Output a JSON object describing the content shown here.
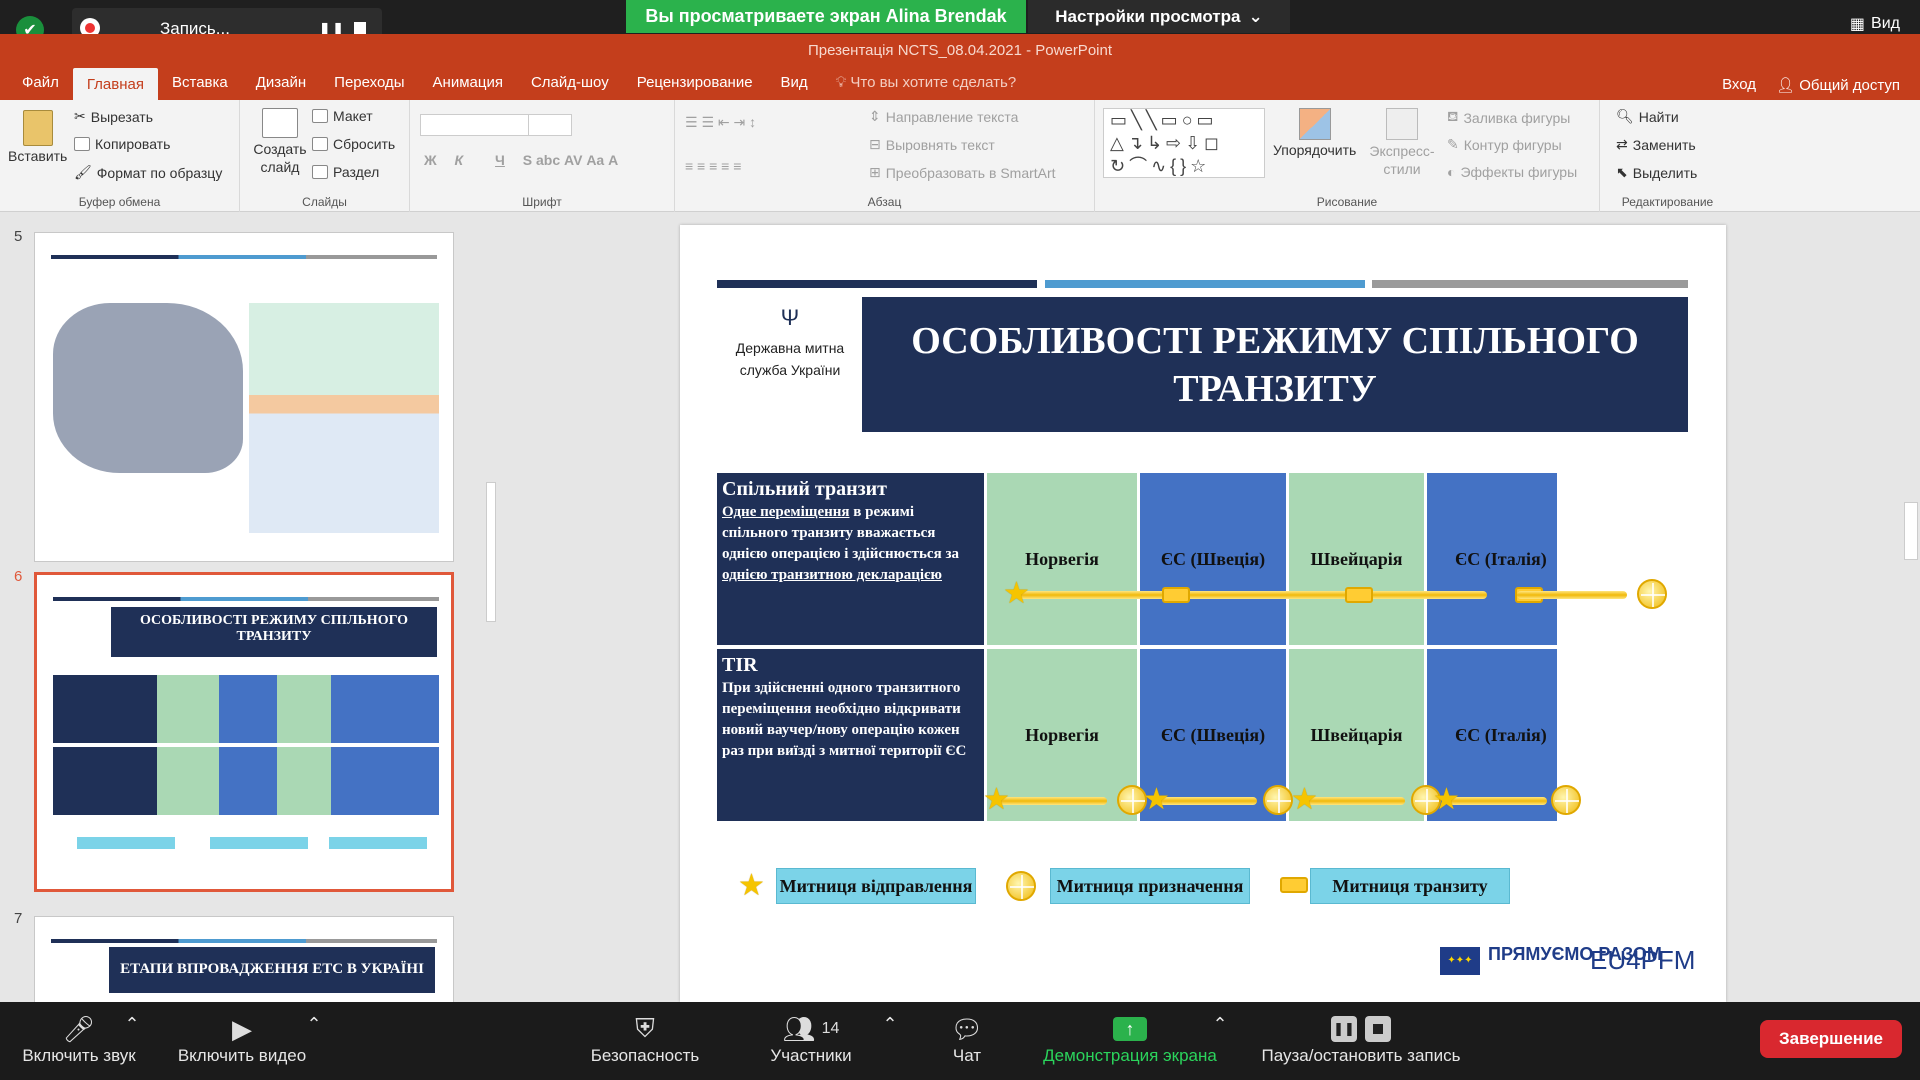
{
  "zoom": {
    "recording_label": "Запись...",
    "share_banner": "Вы просматриваете экран Alina Brendak",
    "view_settings": "Настройки просмотра",
    "view_button": "Вид"
  },
  "powerpoint": {
    "window_title": "Презентація NCTS_08.04.2021 - PowerPoint",
    "menu": [
      "Файл",
      "Главная",
      "Вставка",
      "Дизайн",
      "Переходы",
      "Анимация",
      "Слайд-шоу",
      "Рецензирование",
      "Вид"
    ],
    "tell_me": "Что вы хотите сделать?",
    "sign_in": "Вход",
    "share": "Общий доступ",
    "ribbon": {
      "clipboard": {
        "label": "Буфер обмена",
        "paste": "Вставить",
        "cut": "Вырезать",
        "copy": "Копировать",
        "format_painter": "Формат по образцу"
      },
      "slides": {
        "label": "Слайды",
        "new_slide": "Создать слайд",
        "layout": "Макет",
        "reset": "Сбросить",
        "section": "Раздел"
      },
      "font": {
        "label": "Шрифт"
      },
      "paragraph": {
        "label": "Абзац",
        "text_direction": "Направление текста",
        "align_text": "Выровнять текст",
        "smartart": "Преобразовать в SmartArt"
      },
      "drawing": {
        "label": "Рисование",
        "arrange": "Упорядочить",
        "quick_styles": "Экспресс-стили",
        "shape_fill": "Заливка фигуры",
        "shape_outline": "Контур фигуры",
        "shape_effects": "Эффекты фигуры"
      },
      "editing": {
        "label": "Редактирование",
        "find": "Найти",
        "replace": "Заменить",
        "select": "Выделить"
      }
    }
  },
  "slides_panel": {
    "numbers": [
      "5",
      "6",
      "7"
    ],
    "slide6_title": "ОСОБЛИВОСТІ РЕЖИМУ СПІЛЬНОГО ТРАНЗИТУ",
    "slide7_title": "ЕТАПИ ВПРОВАДЖЕННЯ ЕТС В УКРАЇНІ"
  },
  "slide": {
    "org": "Державна митна служба України",
    "title": "ОСОБЛИВОСТІ РЕЖИМУ СПІЛЬНОГО ТРАНЗИТУ",
    "rows": [
      {
        "head": "Спільний транзит",
        "text_underlined_1": "Одне переміщення",
        "text_1": " в режимі спільного транзиту вважається однією операцією і здійснюється за ",
        "text_underlined_2": "однією транзитною декларацією",
        "cells": [
          "Норвегія",
          "ЄС (Швеція)",
          "Швейцарія",
          "ЄС (Італія)"
        ]
      },
      {
        "head": "TIR",
        "text": "При здійсненні одного транзитного переміщення необхідно відкривати новий ваучер/нову операцію кожен раз при виїзді з митної території ЄС",
        "cells": [
          "Норвегія",
          "ЄС (Швеція)",
          "Швейцарія",
          "ЄС (Італія)"
        ]
      }
    ],
    "legend": [
      "Митниця відправлення",
      "Митниця призначення",
      "Митниця транзиту"
    ],
    "partners": [
      "ПРЯМУЄМО РАЗОМ",
      "EU4PFM"
    ]
  },
  "bottom": {
    "unmute": "Включить звук",
    "video": "Включить видео",
    "security": "Безопасность",
    "participants": "Участники",
    "participants_count": "14",
    "chat": "Чат",
    "share_screen": "Демонстрация экрана",
    "pause_record": "Пауза/остановить запись",
    "end": "Завершение"
  },
  "colors": {
    "ppt_accent": "#c43e1c",
    "slide_navy": "#1f3057",
    "cell_green": "#aad8b4",
    "cell_blue": "#4472c4",
    "zoom_green": "#2bb24c",
    "end_red": "#d9282f"
  }
}
